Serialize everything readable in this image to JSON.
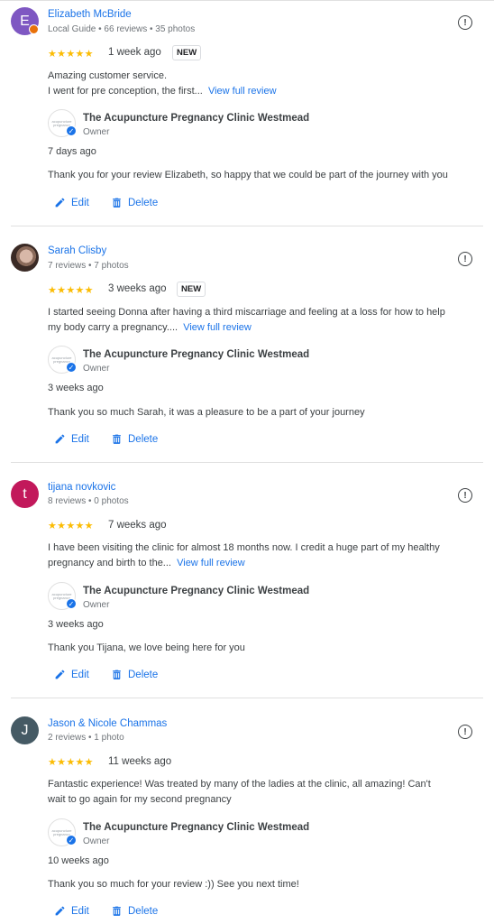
{
  "colors": {
    "link": "#1a73e8",
    "star": "#fbbc04",
    "text": "#3c4043",
    "meta": "#70757a"
  },
  "business": {
    "name": "The Acupuncture Pregnancy Clinic Westmead",
    "owner_label": "Owner",
    "logo_text": "acupuncture pregnancy"
  },
  "actions": {
    "edit": "Edit",
    "delete": "Delete"
  },
  "reviews": [
    {
      "avatar_letter": "E",
      "avatar_color": "#7e57c2",
      "name": "Elizabeth McBride",
      "meta": "Local Guide • 66 reviews • 35 photos",
      "stars": "★★★★★",
      "rating": 5,
      "time": "1 week ago",
      "badge": "NEW",
      "text_line1": "Amazing customer service.",
      "text_line2": "I went for pre conception, the first...",
      "view_full": "View full review",
      "reply_time": "7 days ago",
      "reply": "Thank you for your review Elizabeth, so happy that we could be part of the journey with you"
    },
    {
      "avatar_letter": "",
      "avatar_color": "#6d4c41",
      "name": "Sarah Clisby",
      "meta": "7 reviews • 7 photos",
      "stars": "★★★★★",
      "rating": 5,
      "time": "3 weeks ago",
      "badge": "NEW",
      "text_line1": "I started seeing Donna after having a third miscarriage and feeling at a loss for how to help",
      "text_line2": "my body carry a pregnancy....",
      "view_full": "View full review",
      "reply_time": "3 weeks ago",
      "reply": "Thank you so much Sarah, it was a pleasure to be a part of your journey"
    },
    {
      "avatar_letter": "t",
      "avatar_color": "#c2185b",
      "name": "tijana novkovic",
      "meta": "8 reviews • 0 photos",
      "stars": "★★★★★",
      "rating": 5,
      "time": "7 weeks ago",
      "badge": "",
      "text_line1": "I have been visiting the clinic for almost 18 months now. I credit a huge part of my healthy",
      "text_line2": "pregnancy and birth to the...",
      "view_full": "View full review",
      "reply_time": "3 weeks ago",
      "reply": "Thank you Tijana, we love being here for you"
    },
    {
      "avatar_letter": "J",
      "avatar_color": "#455a64",
      "name": "Jason & Nicole Chammas",
      "meta": "2 reviews • 1 photo",
      "stars": "★★★★★",
      "rating": 5,
      "time": "11 weeks ago",
      "badge": "",
      "text_line1": "Fantastic experience! Was treated by many of the ladies at the clinic, all amazing! Can't",
      "text_line2": "wait to go again for my second pregnancy",
      "view_full": "",
      "reply_time": "10 weeks ago",
      "reply": "Thank you so much for your review :)) See you next time!"
    }
  ]
}
